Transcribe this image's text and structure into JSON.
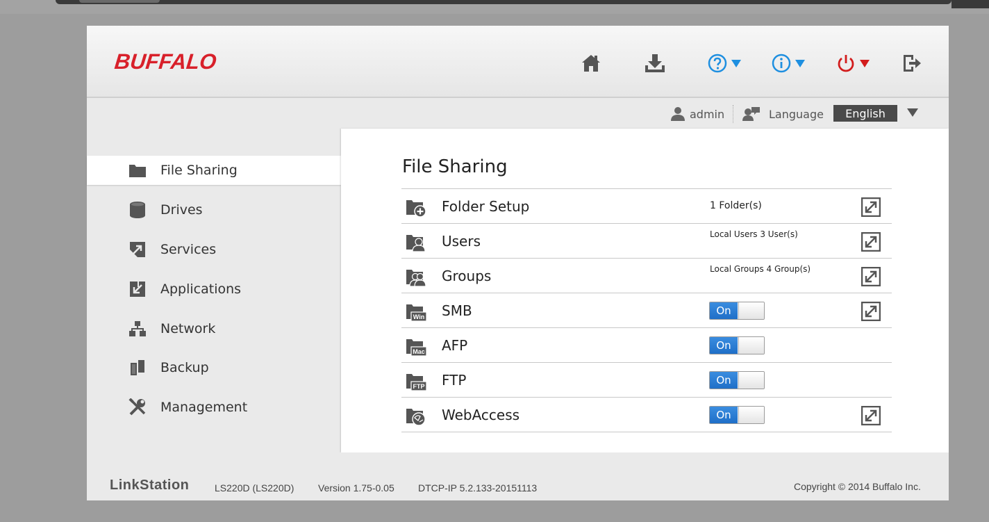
{
  "brand": {
    "logo": "BUFFALO",
    "accent": "#d8202a"
  },
  "header": {
    "icons": [
      "home-icon",
      "download-icon",
      "help-icon",
      "info-icon",
      "power-icon",
      "logout-icon"
    ]
  },
  "userbar": {
    "user": "admin",
    "language_label": "Language",
    "language_value": "English"
  },
  "sidebar": {
    "items": [
      {
        "label": "File Sharing",
        "icon": "folder-icon",
        "active": true
      },
      {
        "label": "Drives",
        "icon": "drive-icon"
      },
      {
        "label": "Services",
        "icon": "services-icon"
      },
      {
        "label": "Applications",
        "icon": "applications-icon"
      },
      {
        "label": "Network",
        "icon": "network-icon"
      },
      {
        "label": "Backup",
        "icon": "backup-icon"
      },
      {
        "label": "Management",
        "icon": "tools-icon"
      }
    ]
  },
  "main": {
    "title": "File Sharing",
    "rows": [
      {
        "label": "Folder Setup",
        "value": "1 Folder(s)",
        "icon": "folder-add-icon"
      },
      {
        "label": "Users",
        "value": "Local Users 3 User(s)",
        "icon": "folder-user-icon"
      },
      {
        "label": "Groups",
        "value": "Local Groups 4 Group(s)",
        "icon": "folder-group-icon"
      },
      {
        "label": "SMB",
        "toggle": "On",
        "icon": "folder-win-icon",
        "icon_text": "Win"
      },
      {
        "label": "AFP",
        "toggle": "On",
        "icon": "folder-mac-icon",
        "icon_text": "Mac"
      },
      {
        "label": "FTP",
        "toggle": "On",
        "icon": "folder-ftp-icon",
        "icon_text": "FTP"
      },
      {
        "label": "WebAccess",
        "toggle": "On",
        "icon": "folder-web-icon"
      }
    ]
  },
  "footer": {
    "product": "LinkStation",
    "model": "LS220D (LS220D)",
    "version": "Version 1.75-0.05",
    "dtcp": "DTCP-IP 5.2.133-20151113",
    "copyright": "Copyright © 2014 Buffalo Inc."
  },
  "colors": {
    "toggle_on": "#1f6fc8",
    "help_blue": "#1e8fe0",
    "power_red": "#d21c1c"
  }
}
